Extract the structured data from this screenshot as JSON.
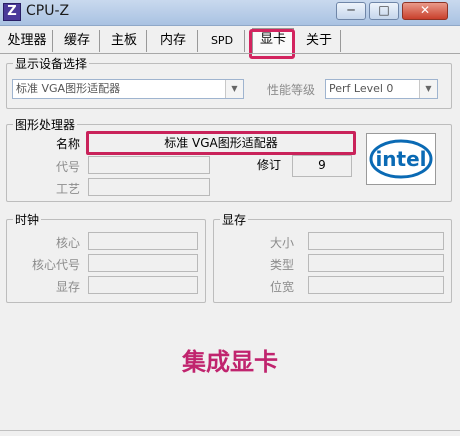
{
  "window": {
    "title": "CPU-Z",
    "icon_letter": "Z",
    "min": "─",
    "max": "□",
    "close": "✕"
  },
  "tabs": [
    {
      "label": "处理器"
    },
    {
      "label": "缓存"
    },
    {
      "label": "主板"
    },
    {
      "label": "内存"
    },
    {
      "label": "SPD"
    },
    {
      "label": "显卡",
      "selected": true
    },
    {
      "label": "关于"
    }
  ],
  "display_select": {
    "group_title": "显示设备选择",
    "device_value": "标准 VGA图形适配器",
    "perf_label": "性能等级",
    "perf_value": "Perf Level 0"
  },
  "gpu": {
    "group_title": "图形处理器",
    "name_label": "名称",
    "name_value": "标准 VGA图形适配器",
    "codename_label": "代号",
    "process_label": "工艺",
    "revision_label": "修订",
    "revision_value": "9",
    "logo_text": "intel"
  },
  "clocks": {
    "group_title": "时钟",
    "core_label": "核心",
    "shader_label": "核心代号",
    "memory_label": "显存"
  },
  "memory": {
    "group_title": "显存",
    "size_label": "大小",
    "type_label": "类型",
    "width_label": "位宽"
  },
  "caption": "集成显卡",
  "colors": {
    "highlight": "#c9225a",
    "caption": "#c0246e",
    "intel_blue": "#0a6ab4"
  }
}
